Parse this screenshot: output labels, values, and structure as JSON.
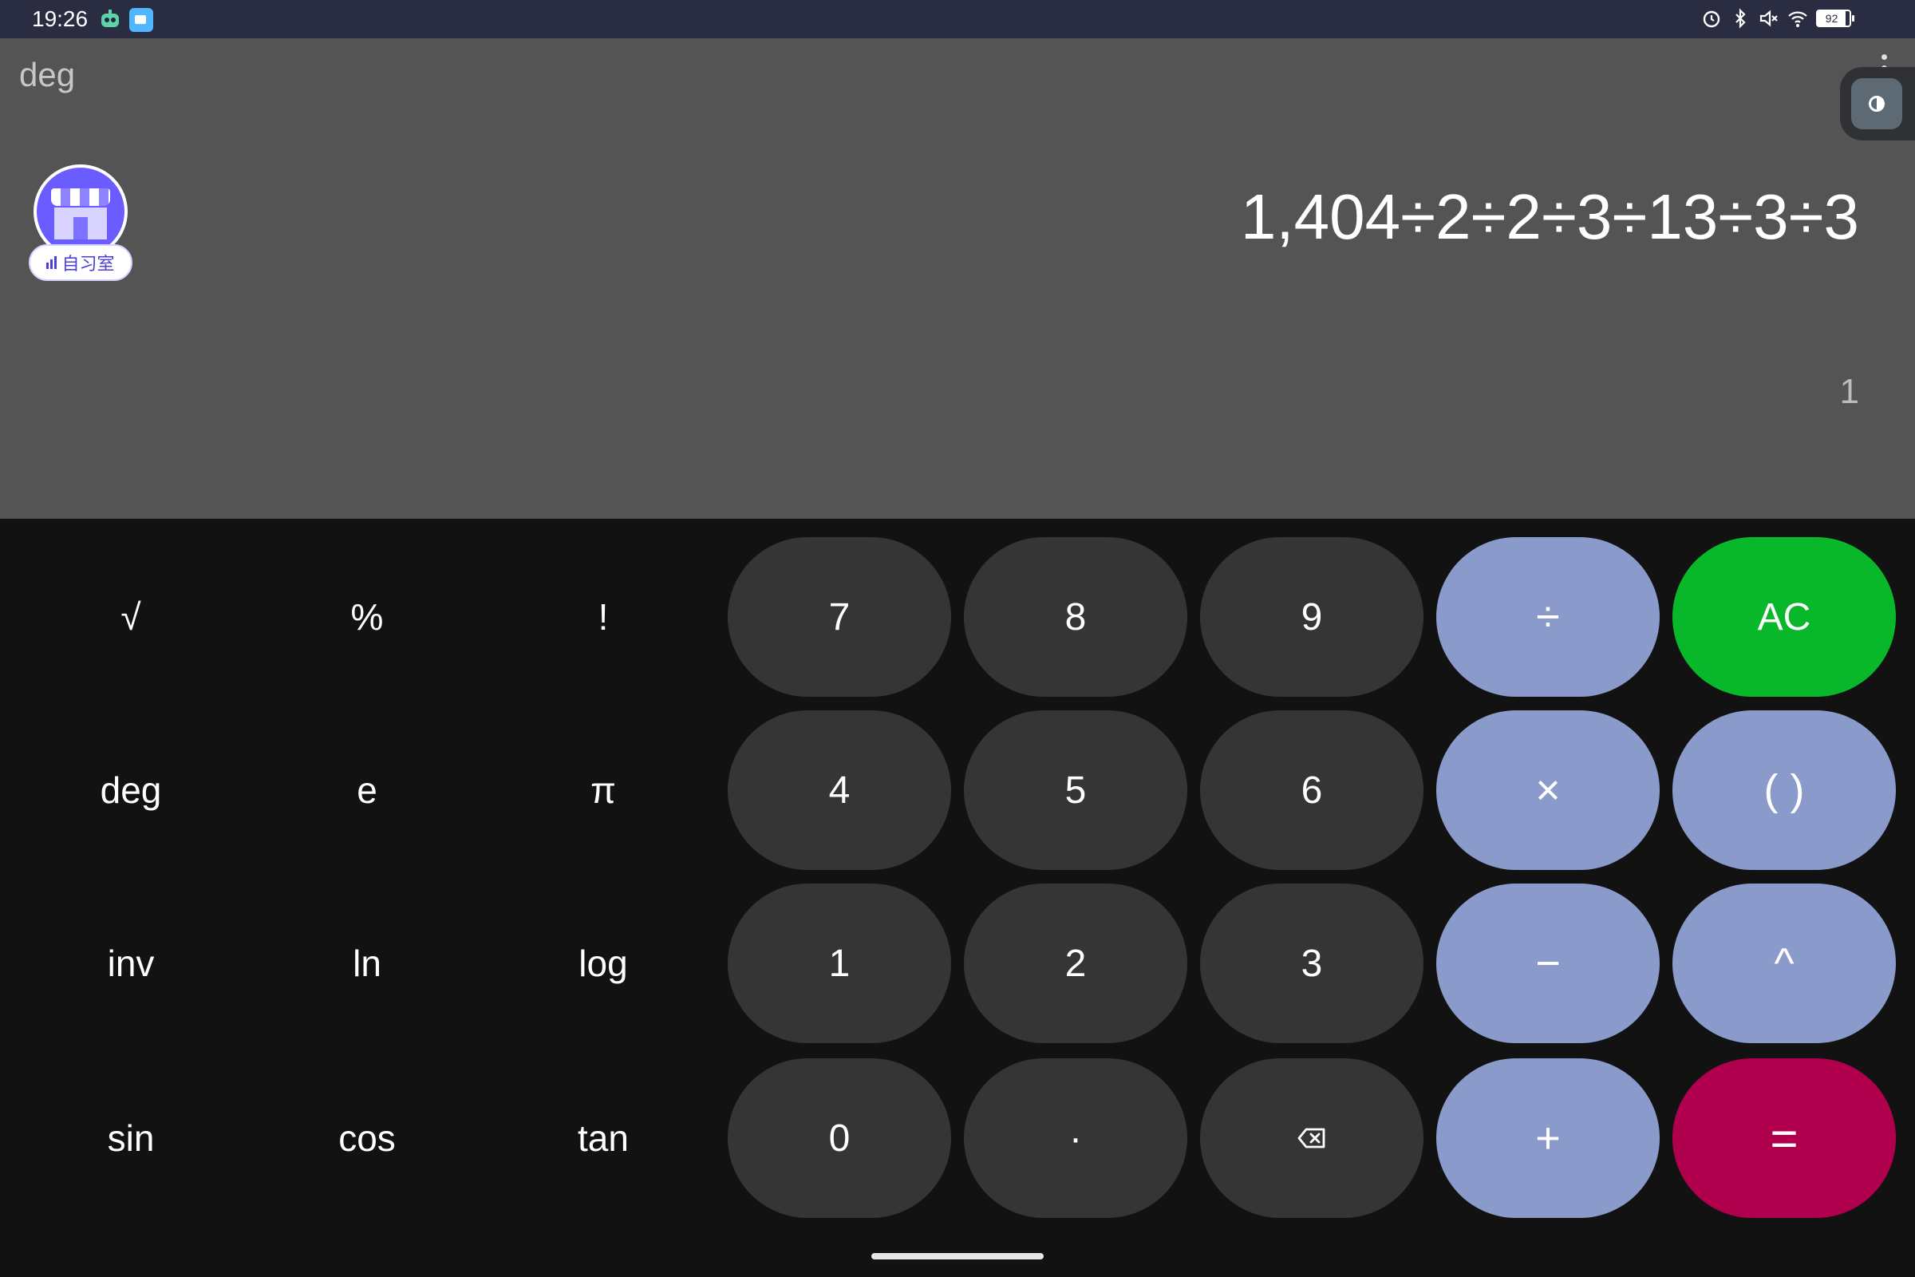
{
  "status_bar": {
    "time": "19:26",
    "battery": "92",
    "icons": [
      "alarm-icon",
      "bluetooth-icon",
      "mute-icon",
      "wifi-icon",
      "battery-icon"
    ]
  },
  "display": {
    "mode": "deg",
    "expression": "1,404÷2÷2÷3÷13÷3÷3",
    "result": "1",
    "floating_app": {
      "label": "自习室",
      "sign": "自习"
    }
  },
  "keypad": {
    "scientific": {
      "sqrt": "√",
      "percent": "%",
      "factorial": "!",
      "deg": "deg",
      "e": "e",
      "pi": "π",
      "inv": "inv",
      "ln": "ln",
      "log": "log",
      "sin": "sin",
      "cos": "cos",
      "tan": "tan"
    },
    "digits": {
      "d7": "7",
      "d8": "8",
      "d9": "9",
      "d4": "4",
      "d5": "5",
      "d6": "6",
      "d1": "1",
      "d2": "2",
      "d3": "3",
      "d0": "0",
      "dot": "·"
    },
    "operators": {
      "divide": "÷",
      "multiply": "×",
      "minus": "−",
      "plus": "+",
      "clear": "AC",
      "parens": "( )",
      "power": "^",
      "equals": "="
    }
  },
  "colors": {
    "display_bg": "#545454",
    "keypad_bg": "#121212",
    "digit_key": "#353535",
    "operator_key": "#8a9bcb",
    "clear_key": "#08b82a",
    "equals_key": "#b0004d"
  }
}
